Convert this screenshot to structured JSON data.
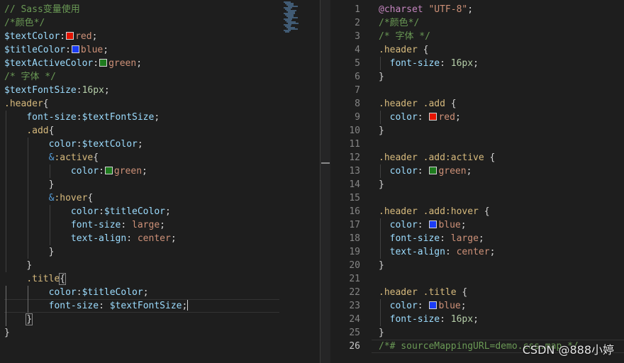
{
  "colors": {
    "red": "#e51400",
    "blue": "#1b3cf5",
    "green": "#1e7a1e",
    "editor_bg": "#1e1e1e"
  },
  "icons": [
    "color-swatch-icon"
  ],
  "left_editor": {
    "lines": [
      [
        [
          "cmt",
          "// Sass变量使用"
        ]
      ],
      [
        [
          "cmt",
          "/*颜色*/"
        ]
      ],
      [
        [
          "var",
          "$textColor"
        ],
        [
          "pun",
          ":"
        ],
        [
          "sw",
          "red"
        ],
        [
          "val",
          "red"
        ],
        [
          "pun",
          ";"
        ]
      ],
      [
        [
          "var",
          "$titleColor"
        ],
        [
          "pun",
          ":"
        ],
        [
          "sw",
          "blue"
        ],
        [
          "val",
          "blue"
        ],
        [
          "pun",
          ";"
        ]
      ],
      [
        [
          "var",
          "$textActiveColor"
        ],
        [
          "pun",
          ":"
        ],
        [
          "sw",
          "green"
        ],
        [
          "val",
          "green"
        ],
        [
          "pun",
          ";"
        ]
      ],
      [
        [
          "cmt",
          "/* 字体 */"
        ]
      ],
      [
        [
          "var",
          "$textFontSize"
        ],
        [
          "pun",
          ":"
        ],
        [
          "num",
          "16px"
        ],
        [
          "pun",
          ";"
        ]
      ],
      [
        [
          "sel",
          ".header"
        ],
        [
          "pun",
          "{"
        ]
      ],
      [
        [
          "sp",
          "    "
        ],
        [
          "prop",
          "font-size"
        ],
        [
          "pun",
          ":"
        ],
        [
          "var",
          "$textFontSize"
        ],
        [
          "pun",
          ";"
        ]
      ],
      [
        [
          "sp",
          "    "
        ],
        [
          "sel",
          ".add"
        ],
        [
          "pun",
          "{"
        ]
      ],
      [
        [
          "sp",
          "        "
        ],
        [
          "prop",
          "color"
        ],
        [
          "pun",
          ":"
        ],
        [
          "var",
          "$textColor"
        ],
        [
          "pun",
          ";"
        ]
      ],
      [
        [
          "sp",
          "        "
        ],
        [
          "amp",
          "&"
        ],
        [
          "sel",
          ":active"
        ],
        [
          "pun",
          "{"
        ]
      ],
      [
        [
          "sp",
          "            "
        ],
        [
          "prop",
          "color"
        ],
        [
          "pun",
          ":"
        ],
        [
          "sw",
          "green"
        ],
        [
          "val",
          "green"
        ],
        [
          "pun",
          ";"
        ]
      ],
      [
        [
          "sp",
          "        "
        ],
        [
          "pun",
          "}"
        ]
      ],
      [
        [
          "sp",
          "        "
        ],
        [
          "amp",
          "&"
        ],
        [
          "sel",
          ":hover"
        ],
        [
          "pun",
          "{"
        ]
      ],
      [
        [
          "sp",
          "            "
        ],
        [
          "prop",
          "color"
        ],
        [
          "pun",
          ":"
        ],
        [
          "var",
          "$titleColor"
        ],
        [
          "pun",
          ";"
        ]
      ],
      [
        [
          "sp",
          "            "
        ],
        [
          "prop",
          "font-size"
        ],
        [
          "pun",
          ": "
        ],
        [
          "val",
          "large"
        ],
        [
          "pun",
          ";"
        ]
      ],
      [
        [
          "sp",
          "            "
        ],
        [
          "prop",
          "text-align"
        ],
        [
          "pun",
          ": "
        ],
        [
          "val",
          "center"
        ],
        [
          "pun",
          ";"
        ]
      ],
      [
        [
          "sp",
          "        "
        ],
        [
          "pun",
          "}"
        ]
      ],
      [
        [
          "sp",
          "    "
        ],
        [
          "pun",
          "}"
        ]
      ],
      [
        [
          "sp",
          "    "
        ],
        [
          "sel",
          ".title"
        ],
        [
          "hl",
          "{"
        ]
      ],
      [
        [
          "sp",
          "        "
        ],
        [
          "prop",
          "color"
        ],
        [
          "pun",
          ":"
        ],
        [
          "var",
          "$titleColor"
        ],
        [
          "pun",
          ";"
        ]
      ],
      [
        [
          "sp",
          "        "
        ],
        [
          "prop",
          "font-size"
        ],
        [
          "pun",
          ": "
        ],
        [
          "var",
          "$textFontSize"
        ],
        [
          "pun",
          ";"
        ],
        [
          "caret",
          ""
        ]
      ],
      [
        [
          "sp",
          "    "
        ],
        [
          "hl",
          "}"
        ]
      ],
      [
        [
          "pun",
          "}"
        ]
      ]
    ]
  },
  "right_editor": {
    "current_line": 26,
    "lines": [
      [
        [
          "at",
          "@charset"
        ],
        [
          "pun",
          " "
        ],
        [
          "val",
          "\"UTF-8\""
        ],
        [
          "pun",
          ";"
        ]
      ],
      [
        [
          "cmt",
          "/*颜色*/"
        ]
      ],
      [
        [
          "cmt",
          "/* 字体 */"
        ]
      ],
      [
        [
          "sel",
          ".header"
        ],
        [
          "pun",
          " {"
        ]
      ],
      [
        [
          "sp",
          "  "
        ],
        [
          "prop",
          "font-size"
        ],
        [
          "pun",
          ": "
        ],
        [
          "num",
          "16px"
        ],
        [
          "pun",
          ";"
        ]
      ],
      [
        [
          "pun",
          "}"
        ]
      ],
      [],
      [
        [
          "sel",
          ".header .add"
        ],
        [
          "pun",
          " {"
        ]
      ],
      [
        [
          "sp",
          "  "
        ],
        [
          "prop",
          "color"
        ],
        [
          "pun",
          ": "
        ],
        [
          "sw",
          "red"
        ],
        [
          "val",
          "red"
        ],
        [
          "pun",
          ";"
        ]
      ],
      [
        [
          "pun",
          "}"
        ]
      ],
      [],
      [
        [
          "sel",
          ".header .add:active"
        ],
        [
          "pun",
          " {"
        ]
      ],
      [
        [
          "sp",
          "  "
        ],
        [
          "prop",
          "color"
        ],
        [
          "pun",
          ": "
        ],
        [
          "sw",
          "green"
        ],
        [
          "val",
          "green"
        ],
        [
          "pun",
          ";"
        ]
      ],
      [
        [
          "pun",
          "}"
        ]
      ],
      [],
      [
        [
          "sel",
          ".header .add:hover"
        ],
        [
          "pun",
          " {"
        ]
      ],
      [
        [
          "sp",
          "  "
        ],
        [
          "prop",
          "color"
        ],
        [
          "pun",
          ": "
        ],
        [
          "sw",
          "blue"
        ],
        [
          "val",
          "blue"
        ],
        [
          "pun",
          ";"
        ]
      ],
      [
        [
          "sp",
          "  "
        ],
        [
          "prop",
          "font-size"
        ],
        [
          "pun",
          ": "
        ],
        [
          "val",
          "large"
        ],
        [
          "pun",
          ";"
        ]
      ],
      [
        [
          "sp",
          "  "
        ],
        [
          "prop",
          "text-align"
        ],
        [
          "pun",
          ": "
        ],
        [
          "val",
          "center"
        ],
        [
          "pun",
          ";"
        ]
      ],
      [
        [
          "pun",
          "}"
        ]
      ],
      [],
      [
        [
          "sel",
          ".header .title"
        ],
        [
          "pun",
          " {"
        ]
      ],
      [
        [
          "sp",
          "  "
        ],
        [
          "prop",
          "color"
        ],
        [
          "pun",
          ": "
        ],
        [
          "sw",
          "blue"
        ],
        [
          "val",
          "blue"
        ],
        [
          "pun",
          ";"
        ]
      ],
      [
        [
          "sp",
          "  "
        ],
        [
          "prop",
          "font-size"
        ],
        [
          "pun",
          ": "
        ],
        [
          "num",
          "16px"
        ],
        [
          "pun",
          ";"
        ]
      ],
      [
        [
          "pun",
          "}"
        ]
      ],
      [
        [
          "cmt",
          "/*# sourceMappingURL=demo.css.map */"
        ]
      ]
    ]
  },
  "watermark": "CSDN @888小婷"
}
